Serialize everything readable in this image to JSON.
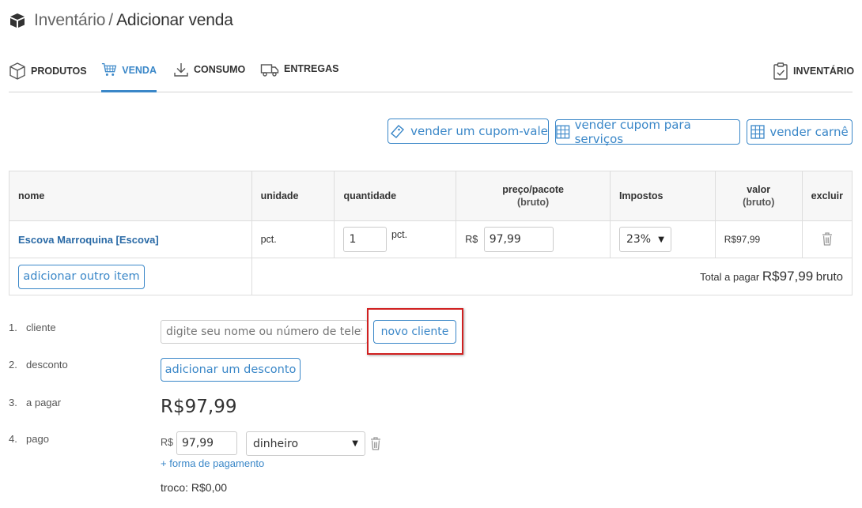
{
  "header": {
    "section": "Inventário",
    "separator": "/",
    "page": "Adicionar venda"
  },
  "tabs": [
    {
      "label": "PRODUTOS",
      "icon": "cube-icon",
      "active": false
    },
    {
      "label": "VENDA",
      "icon": "cart-icon",
      "active": true
    },
    {
      "label": "CONSUMO",
      "icon": "download-icon",
      "active": false
    },
    {
      "label": "ENTREGAS",
      "icon": "truck-icon",
      "active": false
    },
    {
      "label": "INVENTÁRIO",
      "icon": "clipboard-check-icon",
      "active": false
    }
  ],
  "actions": {
    "voucher": "vender um cupom-vale",
    "service_coupon": "vender cupom para serviços",
    "carne": "vender carnê"
  },
  "table": {
    "headers": {
      "name": "nome",
      "unit": "unidade",
      "quantity": "quantidade",
      "price_line1": "preço/pacote",
      "price_line2": "(bruto)",
      "taxes": "Impostos",
      "value_line1": "valor",
      "value_line2": "(bruto)",
      "delete": "excluir"
    },
    "rows": [
      {
        "name": "Escova Marroquina [Escova]",
        "unit": "pct.",
        "quantity": "1",
        "quantity_unit": "pct.",
        "currency": "R$",
        "price": "97,99",
        "tax": "23%",
        "value": "R$97,99"
      }
    ],
    "add_item": "adicionar outro item",
    "total_label": "Total a pagar",
    "total_amount": "R$97,99",
    "total_suffix": "bruto"
  },
  "form": {
    "client": {
      "num": "1.",
      "label": "cliente",
      "placeholder": "digite seu nome ou número de telefone",
      "new_button": "novo cliente"
    },
    "discount": {
      "num": "2.",
      "label": "desconto",
      "button": "adicionar um desconto"
    },
    "to_pay": {
      "num": "3.",
      "label": "a pagar",
      "amount": "R$97,99"
    },
    "paid": {
      "num": "4.",
      "label": "pago",
      "currency": "R$",
      "amount": "97,99",
      "method": "dinheiro",
      "add_method": "+ forma de pagamento",
      "change": "troco: R$0,00"
    }
  },
  "colors": {
    "accent": "#3a87c8",
    "highlight": "#d02020",
    "link": "#2a6aa6"
  }
}
